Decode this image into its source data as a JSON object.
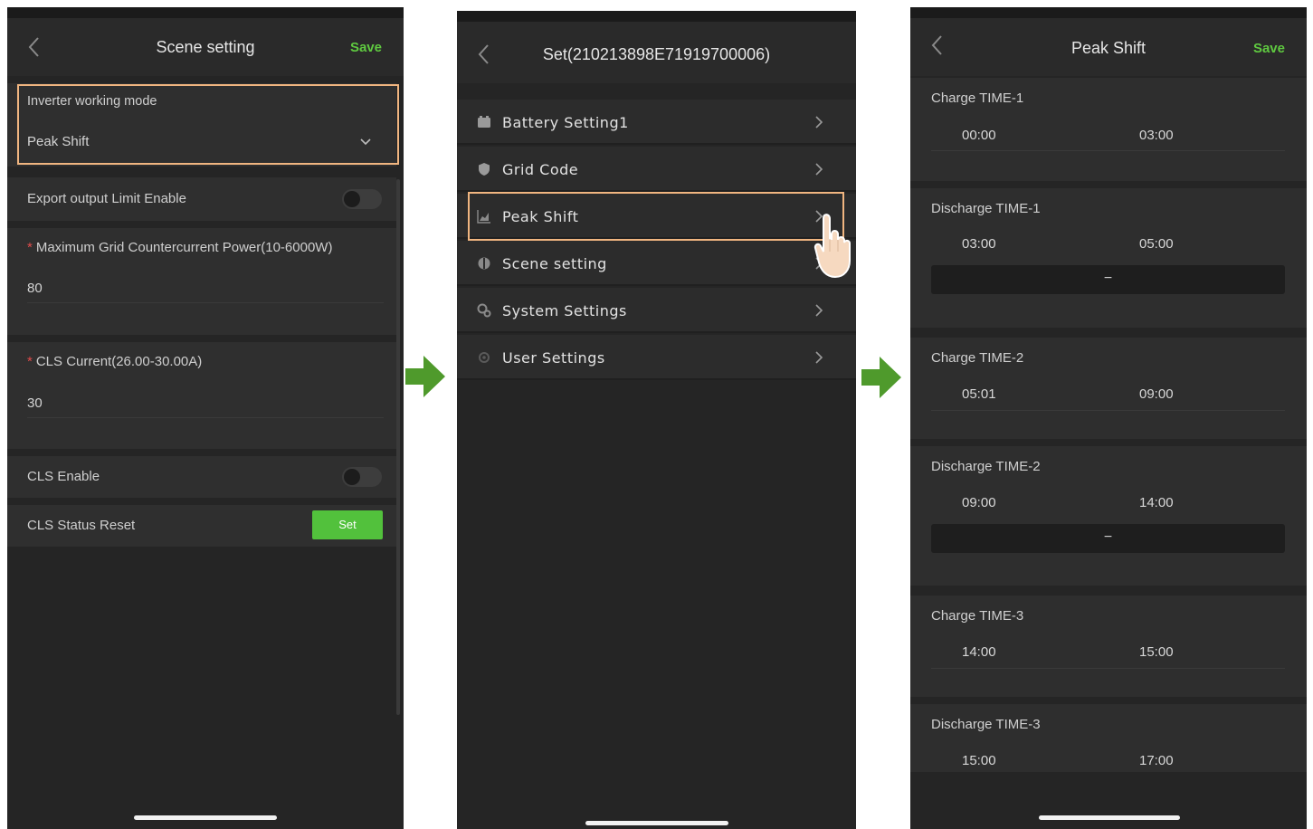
{
  "screen1": {
    "title": "Scene setting",
    "save": "Save",
    "mode_label": "Inverter working mode",
    "mode_value": "Peak Shift",
    "export_limit_label": "Export output Limit Enable",
    "export_limit_enabled": false,
    "max_power_label": "Maximum Grid Countercurrent Power(10-6000W)",
    "max_power_value": "80",
    "cls_current_label": "CLS Current(26.00-30.00A)",
    "cls_current_value": "30",
    "cls_enable_label": "CLS Enable",
    "cls_enable_enabled": false,
    "cls_reset_label": "CLS Status Reset",
    "set_button": "Set",
    "required_mark": "*"
  },
  "screen2": {
    "title": "Set(210213898E71919700006)",
    "items": [
      {
        "label": "Battery Setting1",
        "icon": "battery-icon"
      },
      {
        "label": "Grid Code",
        "icon": "shield-icon"
      },
      {
        "label": "Peak Shift",
        "icon": "chart-icon"
      },
      {
        "label": "Scene setting",
        "icon": "scene-icon"
      },
      {
        "label": "System Settings",
        "icon": "gears-icon"
      },
      {
        "label": "User Settings",
        "icon": "user-gear-icon"
      }
    ]
  },
  "screen3": {
    "title": "Peak Shift",
    "save": "Save",
    "minus": "−",
    "slots": [
      {
        "title": "Charge TIME-1",
        "start": "00:00",
        "end": "03:00"
      },
      {
        "title": "Discharge TIME-1",
        "start": "03:00",
        "end": "05:00"
      },
      {
        "title": "Charge TIME-2",
        "start": "05:01",
        "end": "09:00"
      },
      {
        "title": "Discharge TIME-2",
        "start": "09:00",
        "end": "14:00"
      },
      {
        "title": "Charge TIME-3",
        "start": "14:00",
        "end": "15:00"
      },
      {
        "title": "Discharge TIME-3",
        "start": "15:00",
        "end": "17:00"
      }
    ]
  },
  "colors": {
    "accent_green": "#5fc940",
    "highlight": "#f0b580",
    "step_arrow": "#4f9a2c",
    "background_dark": "#252525"
  }
}
